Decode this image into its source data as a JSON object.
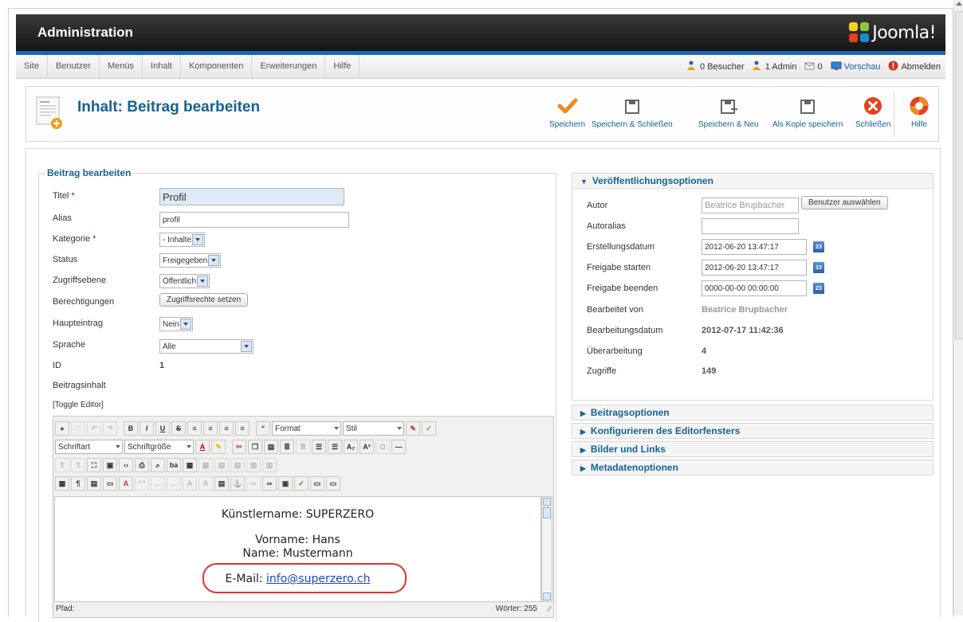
{
  "header": {
    "title": "Administration",
    "logo_text": "Joomla!"
  },
  "menu": {
    "items": [
      "Site",
      "Benutzer",
      "Menüs",
      "Inhalt",
      "Komponenten",
      "Erweiterungen",
      "Hilfe"
    ]
  },
  "status": {
    "visitors": "0 Besucher",
    "admins": "1 Admin",
    "messages": "0",
    "preview": "Vorschau",
    "logout": "Abmelden"
  },
  "toolbar": {
    "page_title": "Inhalt: Beitrag bearbeiten",
    "save": "Speichern",
    "save_close": "Speichern & Schließen",
    "save_new": "Speichern & Neu",
    "save_copy": "Als Kopie speichern",
    "close": "Schließen",
    "help": "Hilfe"
  },
  "form": {
    "legend": "Beitrag bearbeiten",
    "title_label": "Titel",
    "title_value": "Profil",
    "alias_label": "Alias",
    "alias_value": "profil",
    "category_label": "Kategorie",
    "category_value": "- Inhalte",
    "status_label": "Status",
    "status_value": "Freigegeben",
    "access_label": "Zugriffsebene",
    "access_value": "Öffentlich",
    "permissions_label": "Berechtigungen",
    "permissions_button": "Zugriffsrechte setzen",
    "featured_label": "Haupteintrag",
    "featured_value": "Nein",
    "language_label": "Sprache",
    "language_value": "Alle",
    "id_label": "ID",
    "id_value": "1",
    "content_label": "Beitragsinhalt",
    "toggle_editor": "[Toggle Editor]",
    "required_mark": "*"
  },
  "editor": {
    "format_select": "Format",
    "style_select": "Stil",
    "font_select": "Schriftart",
    "size_select": "Schriftgröße",
    "content": {
      "line1": "Künstlername: SUPERZERO",
      "line2": "Vorname: Hans",
      "line3": "Name: Mustermann",
      "email_label": "E-Mail:",
      "email_link": "info@superzero.ch"
    },
    "path_label": "Pfad:",
    "word_count": "Wörter: 255"
  },
  "publishing": {
    "title": "Veröffentlichungsoptionen",
    "author_label": "Autor",
    "author_placeholder": "Beatrice Brupbacher",
    "select_user_button": "Benutzer auswählen",
    "author_alias_label": "Autoralias",
    "author_alias_value": "",
    "created_label": "Erstellungsdatum",
    "created_value": "2012-06-20 13:47:17",
    "publish_up_label": "Freigabe starten",
    "publish_up_value": "2012-06-20 13:47:17",
    "publish_down_label": "Freigabe beenden",
    "publish_down_value": "0000-00-00 00:00:00",
    "modified_by_label": "Bearbeitet von",
    "modified_by_value": "Beatrice Brupbacher",
    "modified_label": "Bearbeitungsdatum",
    "modified_value": "2012-07-17 11:42:36",
    "revision_label": "Überarbeitung",
    "revision_value": "4",
    "hits_label": "Zugriffe",
    "hits_value": "149",
    "calendar_day": "23"
  },
  "panels": {
    "article_options": "Beitragsoptionen",
    "editor_config": "Konfigurieren des Editorfensters",
    "images_links": "Bilder und Links",
    "metadata": "Metadatenoptionen"
  },
  "colors": {
    "accent": "#146295",
    "header_bar": "#1b66b3",
    "highlight_ring": "#dd3333"
  }
}
